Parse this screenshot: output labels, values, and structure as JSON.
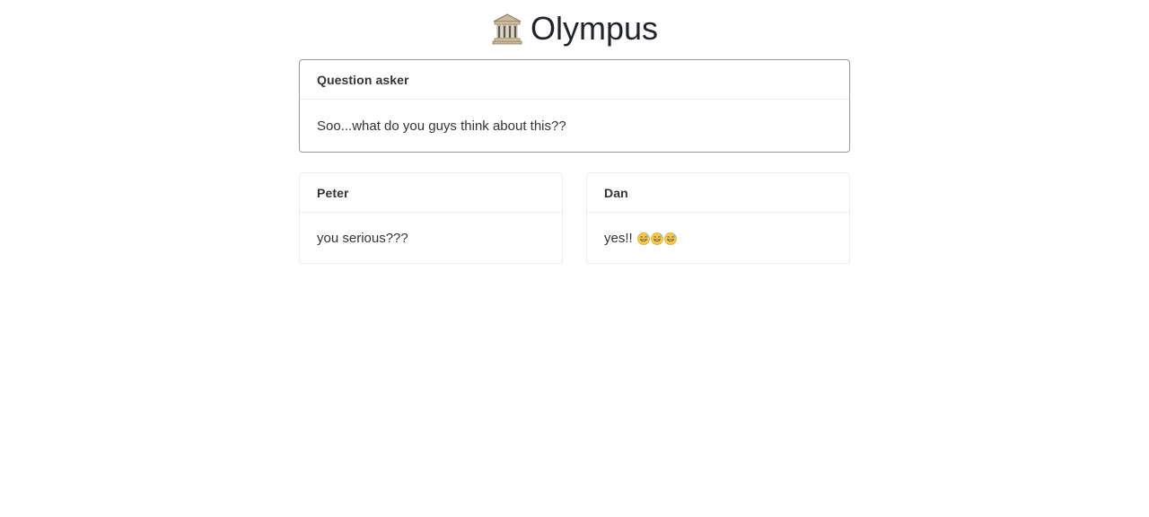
{
  "app": {
    "title": "Olympus",
    "logo_icon": "classical-building-icon"
  },
  "question": {
    "author": "Question asker",
    "text": "Soo...what do you guys think about this??"
  },
  "replies": [
    {
      "author": "Peter",
      "text": "you serious???"
    },
    {
      "author": "Dan",
      "text": "yes!!",
      "emojis": [
        "grinning-sweat-icon",
        "grinning-sweat-icon",
        "grinning-sweat-icon"
      ]
    }
  ],
  "colors": {
    "question_border": "#9a9a9a",
    "card_border": "#ececec",
    "text": "#333333"
  }
}
